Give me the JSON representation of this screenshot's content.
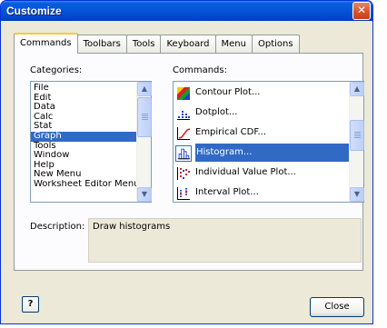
{
  "window": {
    "title": "Customize",
    "close_glyph": "✕"
  },
  "tabs": [
    {
      "label": "Commands",
      "active": true
    },
    {
      "label": "Toolbars",
      "active": false
    },
    {
      "label": "Tools",
      "active": false
    },
    {
      "label": "Keyboard",
      "active": false
    },
    {
      "label": "Menu",
      "active": false
    },
    {
      "label": "Options",
      "active": false
    }
  ],
  "categories": {
    "label": "Categories:",
    "items": [
      "File",
      "Edit",
      "Data",
      "Calc",
      "Stat",
      "Graph",
      "Tools",
      "Window",
      "Help",
      "New Menu",
      "Worksheet Editor Menu"
    ],
    "selected": "Graph"
  },
  "commands": {
    "label": "Commands:",
    "items": [
      {
        "label": "Contour Plot...",
        "icon": "contour-plot-icon"
      },
      {
        "label": "Dotplot...",
        "icon": "dotplot-icon"
      },
      {
        "label": "Empirical CDF...",
        "icon": "empirical-cdf-icon"
      },
      {
        "label": "Histogram...",
        "icon": "histogram-icon"
      },
      {
        "label": "Individual Value Plot...",
        "icon": "individual-value-plot-icon"
      },
      {
        "label": "Interval Plot...",
        "icon": "interval-plot-icon"
      }
    ],
    "selected": "Histogram..."
  },
  "description": {
    "label": "Description:",
    "text": "Draw histograms"
  },
  "buttons": {
    "help_glyph": "?",
    "close": "Close"
  },
  "colors": {
    "selection": "#316ac5",
    "titlebar": "#0553d6",
    "dialog": "#ece9d8"
  }
}
